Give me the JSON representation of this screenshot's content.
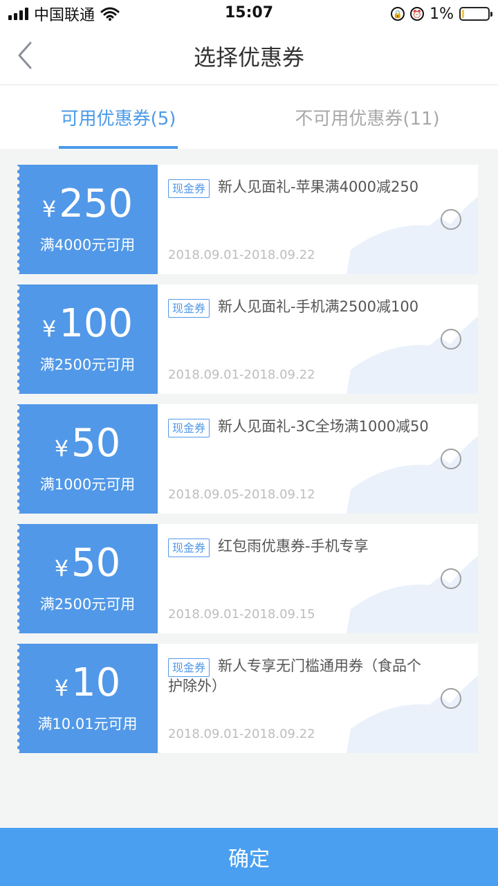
{
  "status_bar": {
    "carrier": "中国联通",
    "time": "15:07",
    "battery_percent": "1%"
  },
  "nav": {
    "title": "选择优惠券"
  },
  "tabs": [
    {
      "label": "可用优惠券(5)",
      "active": true
    },
    {
      "label": "不可用优惠券(11)",
      "active": false
    }
  ],
  "coupons": [
    {
      "currency": "¥",
      "amount": "250",
      "condition": "满4000元可用",
      "tag": "现金券",
      "name": "新人见面礼-苹果满4000减250",
      "date": "2018.09.01-2018.09.22",
      "selected": false
    },
    {
      "currency": "¥",
      "amount": "100",
      "condition": "满2500元可用",
      "tag": "现金券",
      "name": "新人见面礼-手机满2500减100",
      "date": "2018.09.01-2018.09.22",
      "selected": false
    },
    {
      "currency": "¥",
      "amount": "50",
      "condition": "满1000元可用",
      "tag": "现金券",
      "name": "新人见面礼-3C全场满1000减50",
      "date": "2018.09.05-2018.09.12",
      "selected": false
    },
    {
      "currency": "¥",
      "amount": "50",
      "condition": "满2500元可用",
      "tag": "现金券",
      "name": "红包雨优惠券-手机专享",
      "date": "2018.09.01-2018.09.15",
      "selected": false
    },
    {
      "currency": "¥",
      "amount": "10",
      "condition": "满10.01元可用",
      "tag": "现金券",
      "name": "新人专享无门槛通用券（食品个护除外）",
      "date": "2018.09.01-2018.09.22",
      "selected": false
    }
  ],
  "confirm": {
    "label": "确定"
  },
  "colors": {
    "accent": "#4a9ae8",
    "coupon_bg": "#5198e8",
    "confirm_bg": "#4a9ff0"
  },
  "icons": [
    "signal-icon",
    "wifi-icon",
    "rotation-lock-icon",
    "alarm-icon",
    "battery-icon",
    "back-chevron-icon",
    "radio-unchecked-icon"
  ]
}
